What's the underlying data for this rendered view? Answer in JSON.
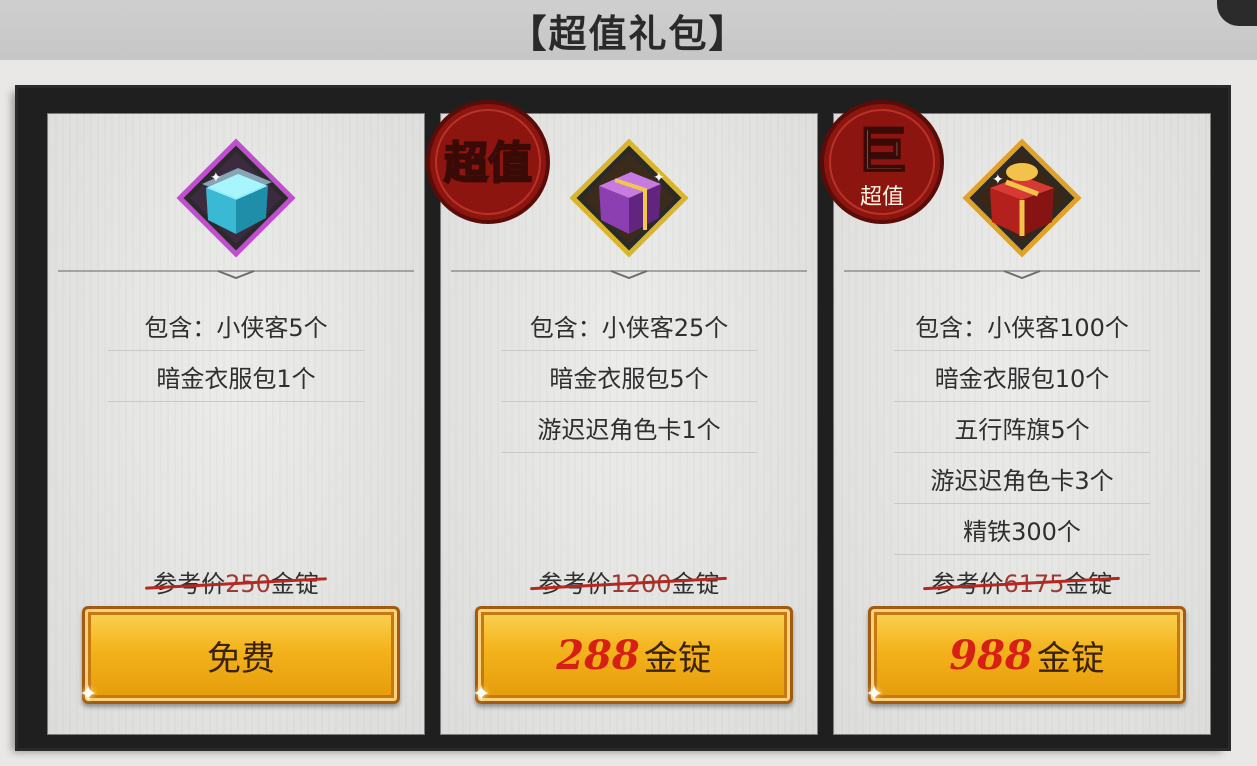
{
  "header": {
    "title": "【超值礼包】"
  },
  "packs": [
    {
      "items": [
        "包含：小侠客5个",
        "暗金衣服包1个"
      ],
      "ref_prefix": "参考价",
      "ref_value": "250",
      "ref_suffix": "金锭",
      "button_label": "免费",
      "color": "#5ed3e6"
    },
    {
      "badge_text": "超值",
      "items": [
        "包含：小侠客25个",
        "暗金衣服包5个",
        "游迟迟角色卡1个"
      ],
      "ref_prefix": "参考价",
      "ref_value": "1200",
      "ref_suffix": "金锭",
      "button_price": "288",
      "button_unit": "金锭",
      "color": "#8b3fb0"
    },
    {
      "badge_big": "巨",
      "badge_small": "超值",
      "items": [
        "包含：小侠客100个",
        "暗金衣服包10个",
        "五行阵旗5个",
        "游迟迟角色卡3个",
        "精铁300个"
      ],
      "ref_prefix": "参考价",
      "ref_value": "6175",
      "ref_suffix": "金锭",
      "button_price": "988",
      "button_unit": "金锭",
      "color": "#b4201c"
    }
  ]
}
